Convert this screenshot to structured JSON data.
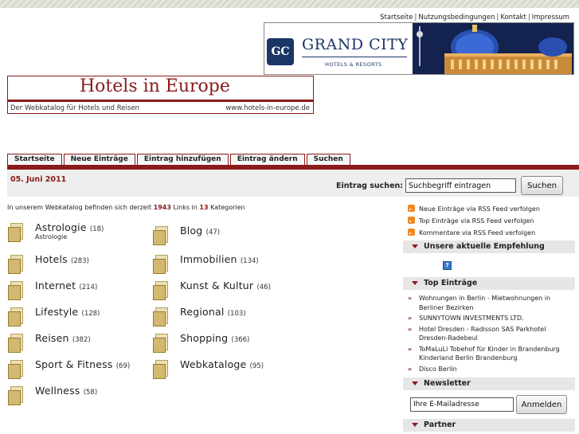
{
  "top_links": [
    "Startseite",
    "Nutzungsbedingungen",
    "Kontakt",
    "Impressum"
  ],
  "grand_city": {
    "logo": "GC",
    "title": "GRAND CITY",
    "subtitle": "HOTELS & RESORTS"
  },
  "hie_banner": {
    "title": "Hotels in Europe",
    "tagline": "Der Webkatalog für Hotels und Reisen",
    "url": "www.hotels-in-europe.de"
  },
  "nav_tabs": [
    "Startseite",
    "Neue Einträge",
    "Eintrag hinzufügen",
    "Eintrag ändern",
    "Suchen"
  ],
  "date": "05. Juni 2011",
  "search": {
    "label": "Eintrag suchen:",
    "value": "Suchbegriff eintragen",
    "button": "Suchen"
  },
  "intro": {
    "prefix": "In unserem Webkatalog befinden sich derzeit",
    "links": "1943",
    "middle": "Links in",
    "categories": "13",
    "suffix": "Kategorien"
  },
  "categories": [
    {
      "name": "Astrologie",
      "count": "(18)",
      "sub": "Astrologie"
    },
    {
      "name": "Blog",
      "count": "(47)"
    },
    {
      "name": "Hotels",
      "count": "(283)"
    },
    {
      "name": "Immobilien",
      "count": "(134)"
    },
    {
      "name": "Internet",
      "count": "(214)"
    },
    {
      "name": "Kunst & Kultur",
      "count": "(46)"
    },
    {
      "name": "Lifestyle",
      "count": "(128)"
    },
    {
      "name": "Regional",
      "count": "(103)"
    },
    {
      "name": "Reisen",
      "count": "(382)"
    },
    {
      "name": "Shopping",
      "count": "(366)"
    },
    {
      "name": "Sport & Fitness",
      "count": "(69)"
    },
    {
      "name": "Webkataloge",
      "count": "(95)"
    },
    {
      "name": "Wellness",
      "count": "(58)"
    }
  ],
  "rss": [
    "Neue Einträge via RSS Feed verfolgen",
    "Top Einträge via RSS Feed verfolgen",
    "Kommentare via RSS Feed verfolgen"
  ],
  "sidebar": {
    "empfehlung": "Unsere aktuelle Empfehlung",
    "top": "Top Einträge",
    "newsletter": "Newsletter",
    "partner": "Partner"
  },
  "top_entries": [
    "Wohnungen in Berlin - Mietwohnungen in Berliner Bezirken",
    "SUNNYTOWN INVESTMENTS LTD.",
    "Hotel Dresden - Radisson SAS Parkhotel Dresden-Radebeul",
    "ToMaLuLi Tobehof für Kinder in Brandenburg Kinderland Berlin Brandenburg",
    "Disco Berlin"
  ],
  "newsletter": {
    "value": "Ihre E-Mailadresse",
    "button": "Anmelden"
  },
  "colors": {
    "brand": "#8b1a1a",
    "navy": "#1b3566"
  }
}
